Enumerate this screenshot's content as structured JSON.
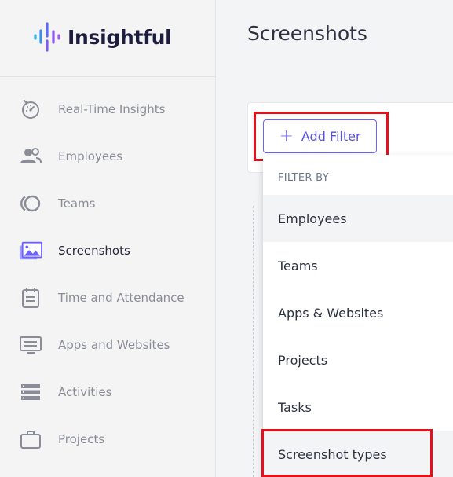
{
  "brand": {
    "name": "Insightful",
    "accent": "#6c63ff"
  },
  "sidebar": {
    "items": [
      {
        "label": "Real-Time Insights",
        "icon": "gauge-icon"
      },
      {
        "label": "Employees",
        "icon": "people-icon"
      },
      {
        "label": "Teams",
        "icon": "teams-icon"
      },
      {
        "label": "Screenshots",
        "icon": "screenshots-icon",
        "active": true
      },
      {
        "label": "Time and Attendance",
        "icon": "calendar-icon"
      },
      {
        "label": "Apps and Websites",
        "icon": "monitor-icon"
      },
      {
        "label": "Activities",
        "icon": "list-icon"
      },
      {
        "label": "Projects",
        "icon": "briefcase-icon"
      }
    ]
  },
  "main": {
    "title": "Screenshots",
    "add_filter_label": "Add Filter",
    "dropdown": {
      "header": "FILTER BY",
      "items": [
        "Employees",
        "Teams",
        "Apps & Websites",
        "Projects",
        "Tasks",
        "Screenshot types"
      ]
    }
  },
  "colors": {
    "highlight": "#e3111e",
    "sidebar_bg": "#f4f4f5"
  }
}
